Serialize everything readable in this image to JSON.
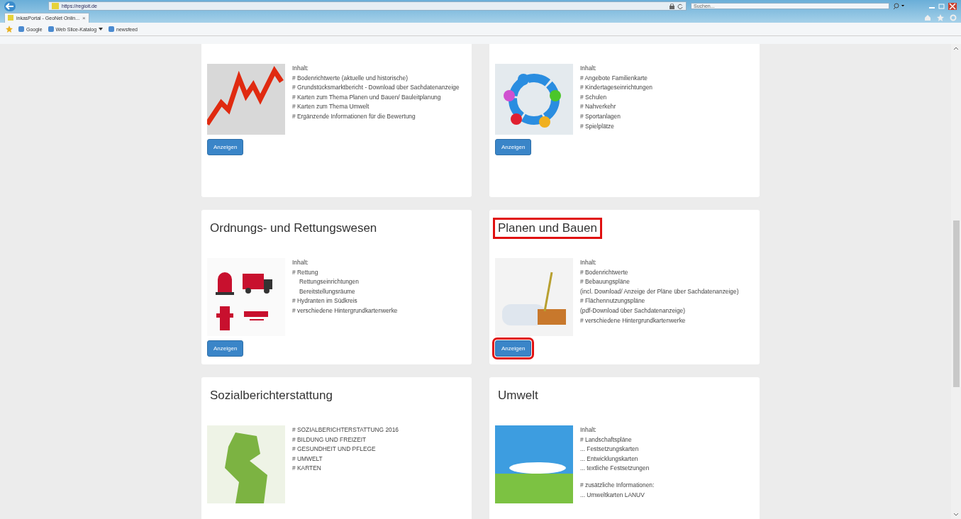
{
  "browser": {
    "url": "https://regioit.de",
    "search": {
      "placeholder": "Suchen..."
    },
    "tabs": [
      {
        "label": "inkasPortal - GeoNet Onlin...",
        "close": "×",
        "selected": true
      }
    ],
    "favorites": [
      {
        "label": "Google",
        "dropdown": false
      },
      {
        "label": "Web Slice-Katalog",
        "dropdown": true
      },
      {
        "label": "newsfeed",
        "dropdown": false
      }
    ]
  },
  "cards": [
    {
      "kind": "chart",
      "highlighted": false,
      "items": [
        {
          "text": "Inhalt:",
          "kind": "item"
        },
        {
          "text": "# Bodenrichtwerte (aktuelle und historische)",
          "kind": "item"
        },
        {
          "text": "# Grundstücksmarktbericht - Download über Sachdatenanzeige",
          "kind": "item"
        },
        {
          "text": "# Karten zum Thema Planen und Bauen/ Bauleitplanung",
          "kind": "item"
        },
        {
          "text": "# Karten zum Thema Umwelt",
          "kind": "item"
        },
        {
          "text": "# Ergänzende Informationen für die Bewertung",
          "kind": "item"
        }
      ],
      "button": "Anzeigen"
    },
    {
      "kind": "people",
      "highlighted": false,
      "items": [
        {
          "text": "Inhalt:",
          "kind": "item"
        },
        {
          "text": "# Angebote Familienkarte",
          "kind": "item"
        },
        {
          "text": "# Kindertageseinrichtungen",
          "kind": "item"
        },
        {
          "text": "# Schulen",
          "kind": "item"
        },
        {
          "text": "# Nahverkehr",
          "kind": "item"
        },
        {
          "text": "# Sportanlagen",
          "kind": "item"
        },
        {
          "text": "# Spielplätze",
          "kind": "item"
        }
      ],
      "button": "Anzeigen"
    },
    {
      "title": "Ordnungs- und Rettungswesen",
      "kind": "emergency",
      "highlighted": false,
      "items": [
        {
          "text": "Inhalt:",
          "kind": "item"
        },
        {
          "text": "# Rettung",
          "kind": "item"
        },
        {
          "text": "Rettungseinrichtungen",
          "kind": "sub"
        },
        {
          "text": "Bereitstellungsräume",
          "kind": "sub"
        },
        {
          "text": "# Hydranten im Südkreis",
          "kind": "item"
        },
        {
          "text": "# verschiedene Hintergrundkartenwerke",
          "kind": "item"
        }
      ],
      "button": "Anzeigen"
    },
    {
      "title": "Planen und Bauen",
      "kind": "plans",
      "highlighted": true,
      "items": [
        {
          "text": "Inhalt:",
          "kind": "item"
        },
        {
          "text": "# Bodenrichtwerte",
          "kind": "item"
        },
        {
          "text": "# Bebauungspläne",
          "kind": "item"
        },
        {
          "text": "(incl. Download/ Anzeige der Pläne über Sachdatenanzeige)",
          "kind": "item"
        },
        {
          "text": "# Flächennutzungspläne",
          "kind": "item"
        },
        {
          "text": "(pdf-Download über Sachdatenanzeige)",
          "kind": "item"
        },
        {
          "text": "# verschiedene Hintergrundkartenwerke",
          "kind": "item"
        }
      ],
      "button": "Anzeigen"
    },
    {
      "title": "Sozialberichterstattung",
      "kind": "map",
      "highlighted": false,
      "items": [
        {
          "text": "# SOZIALBERICHTERSTATTUNG 2016",
          "kind": "item"
        },
        {
          "text": "# BILDUNG UND FREIZEIT",
          "kind": "item"
        },
        {
          "text": "# GESUNDHEIT UND PFLEGE",
          "kind": "item"
        },
        {
          "text": "# UMWELT",
          "kind": "item"
        },
        {
          "text": "# KARTEN",
          "kind": "item"
        }
      ]
    },
    {
      "title": "Umwelt",
      "kind": "nature",
      "highlighted": false,
      "items": [
        {
          "text": "Inhalt:",
          "kind": "item"
        },
        {
          "text": "# Landschaftspläne",
          "kind": "item"
        },
        {
          "text": "... Festsetzungskarten",
          "kind": "item"
        },
        {
          "text": "... Entwicklungskarten",
          "kind": "item"
        },
        {
          "text": "... textliche Festsetzungen",
          "kind": "item"
        },
        {
          "text": "# zusätzliche Informationen:",
          "kind": "gap"
        },
        {
          "text": "... Umweltkarten LANUV",
          "kind": "item"
        }
      ]
    }
  ]
}
